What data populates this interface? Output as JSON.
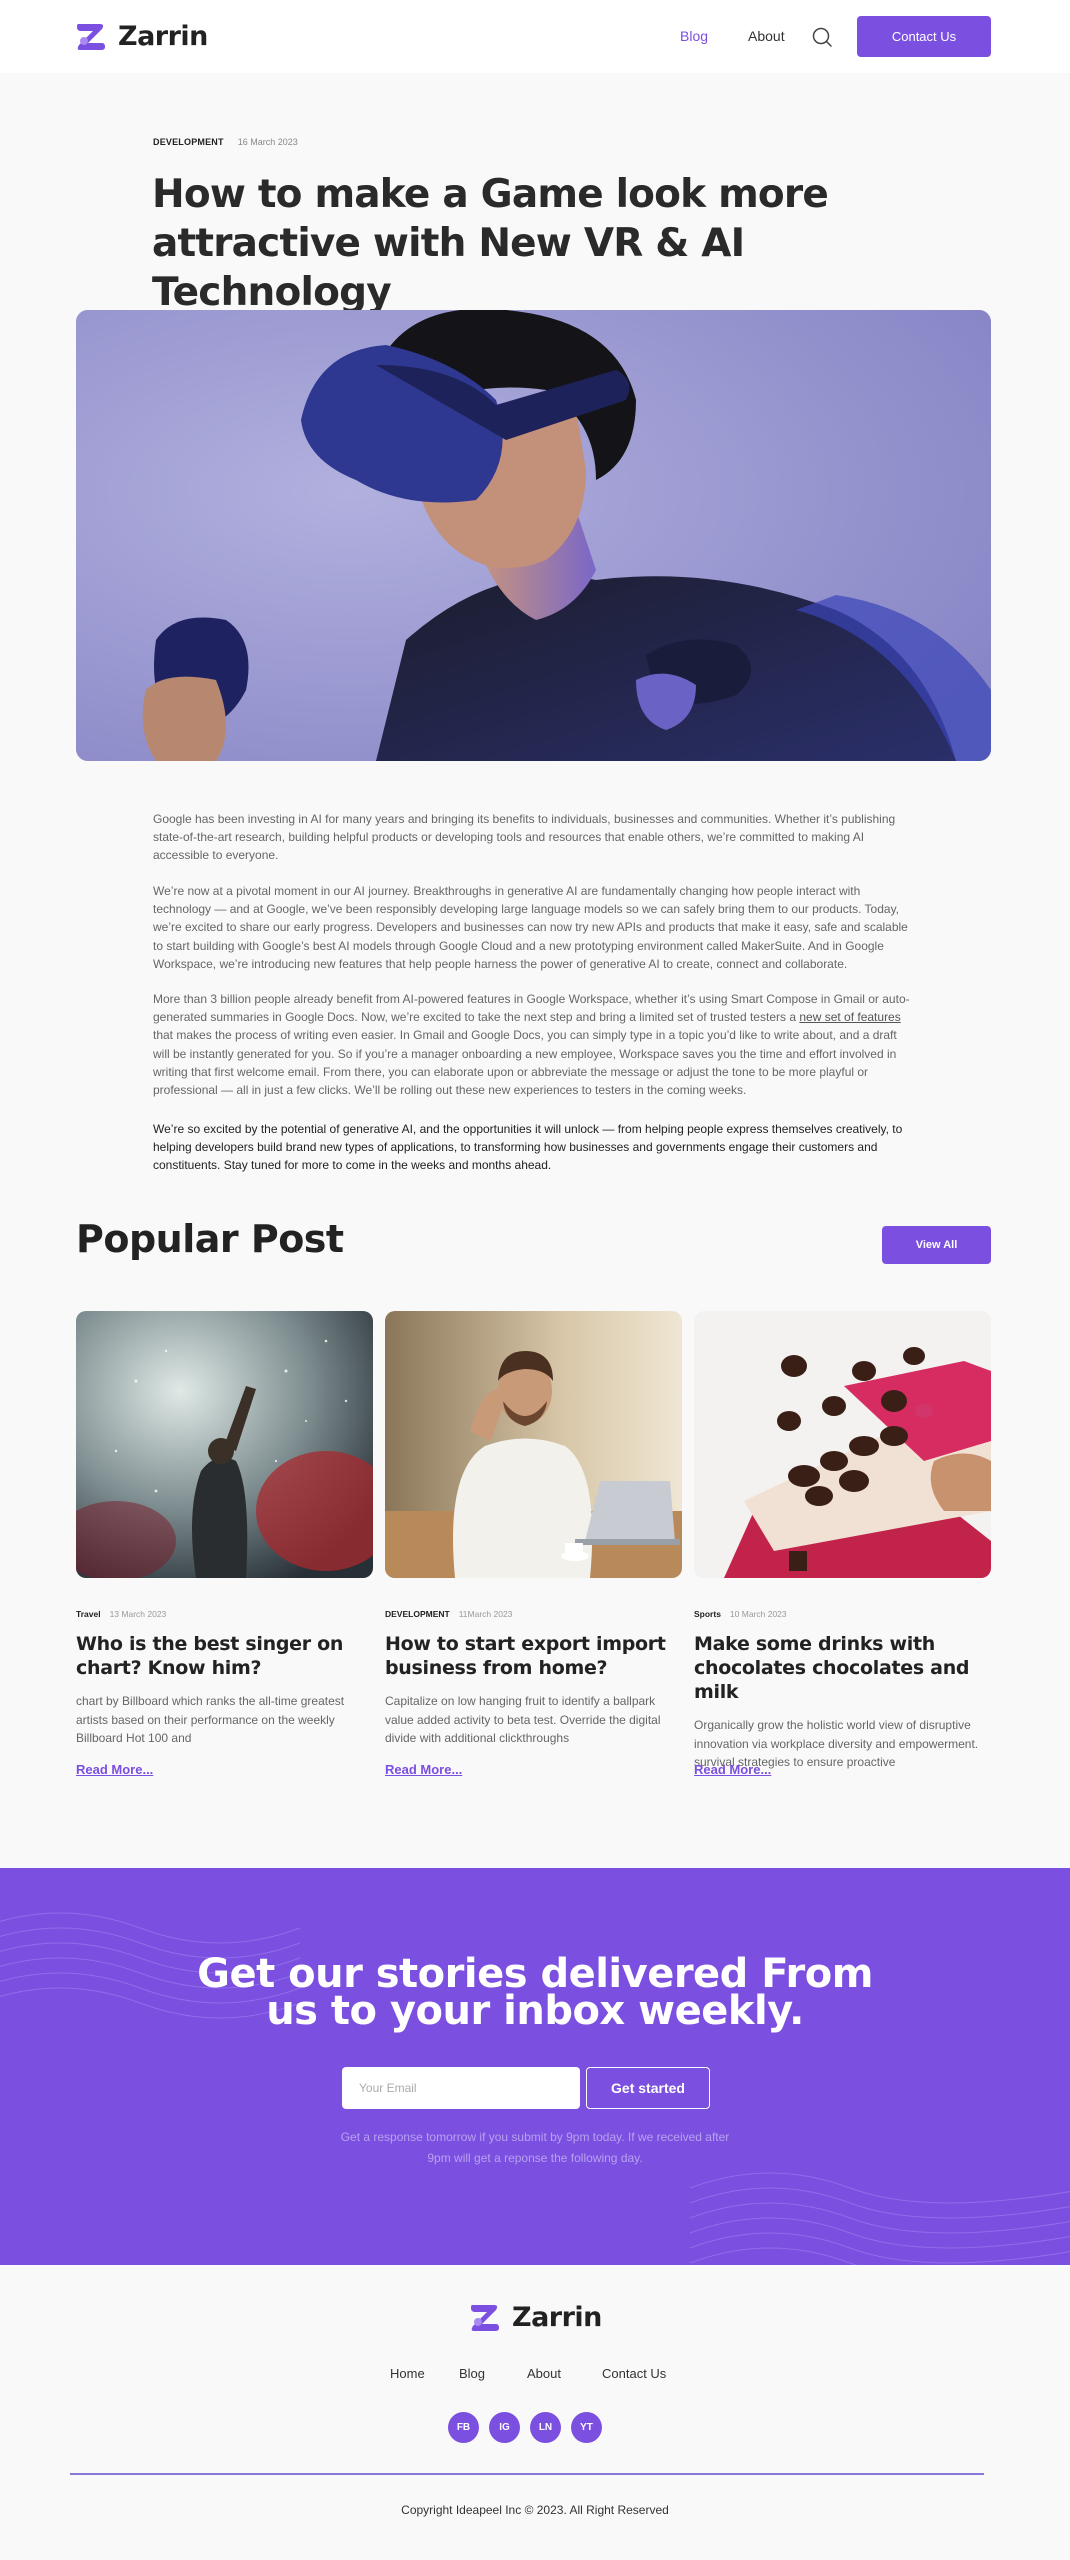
{
  "header": {
    "logo_text": "Zarrin",
    "nav": {
      "blog": "Blog",
      "about": "About"
    },
    "contact_label": "Contact Us"
  },
  "article": {
    "category": "DEVELOPMENT",
    "date": "16 March 2023",
    "title": "How to make a Game look more attractive with New VR & AI Technology",
    "paragraphs": [
      "Google has been investing in AI for many years and bringing its benefits to individuals, businesses and communities. Whether it’s publishing state-of-the-art research, building helpful products or developing tools and resources that enable others, we’re committed to making AI accessible to everyone.",
      "We’re now at a pivotal moment in our AI journey. Breakthroughs in generative AI are fundamentally changing how people interact with technology — and at Google, we’ve been responsibly developing large language models so we can safely bring them to our products. Today, we’re excited to share our early progress. Developers and businesses can now try new APIs and products that make it easy, safe and scalable to start building with Google’s best AI models through Google Cloud and a new prototyping environment called MakerSuite. And in Google Workspace, we’re introducing new features that help people harness the power of generative AI to create, connect and collaborate."
    ],
    "p3_before": "More than 3 billion people already benefit from AI-powered features in Google Workspace, whether it’s using Smart Compose in Gmail or auto-generated summaries in Google Docs. Now, we’re excited to take the next step and bring a limited set of trusted testers a ",
    "p3_link": "new set of features",
    "p3_after": " that makes the process of writing even easier. In Gmail and Google Docs, you can simply type in a topic you’d like to write about, and a draft will be instantly generated for you. So if you’re a manager onboarding a new employee, Workspace saves you the time and effort involved in writing that first welcome email. From there, you can elaborate upon or abbreviate the message or adjust the tone to be more playful or professional — all in just a few clicks. We’ll be rolling out these new experiences to testers in the coming weeks.",
    "closing": "We’re so excited by the potential of generative AI, and the opportunities it will unlock — from helping people express themselves creatively, to helping developers build brand new types of applications, to transforming how businesses and governments engage their customers and constituents. Stay tuned for more to come in the weeks and months ahead."
  },
  "popular": {
    "title": "Popular Post",
    "view_all": "View All",
    "read_more": "Read More...",
    "cards": [
      {
        "category": "Travel",
        "date": "13 March 2023",
        "title": "Who is the best singer on chart? Know him?",
        "excerpt": "chart by Billboard which ranks the all-time greatest artists based on their performance on the weekly Billboard Hot 100 and"
      },
      {
        "category": "DEVELOPMENT",
        "date": "11March 2023",
        "title": "How to start export import business from home?",
        "excerpt": "Capitalize on low hanging fruit to identify a ballpark value added activity to beta test. Override the digital divide with additional clickthroughs"
      },
      {
        "category": "Sports",
        "date": "10 March 2023",
        "title": "Make some drinks with chocolates chocolates and milk",
        "excerpt": "Organically grow the holistic world view of disruptive innovation via workplace diversity and empowerment. survival strategies to ensure proactive"
      }
    ]
  },
  "newsletter": {
    "title_line1": "Get our stories delivered From",
    "title_line2": "us to your inbox weekly.",
    "email_placeholder": "Your Email",
    "button": "Get started",
    "note_line1": "Get a response tomorrow if you submit by 9pm today. If we received after",
    "note_line2": "9pm will get a reponse the following day."
  },
  "footer": {
    "logo_text": "Zarrin",
    "nav": [
      "Home",
      "Blog",
      "About",
      "Contact Us"
    ],
    "socials": [
      "FB",
      "IG",
      "LN",
      "YT"
    ],
    "copyright": "Copyright Ideapeel Inc © 2023. All Right Reserved"
  },
  "colors": {
    "accent": "#7b4fe0",
    "background": "#f9f9f9",
    "text": "#2b2b2b"
  }
}
